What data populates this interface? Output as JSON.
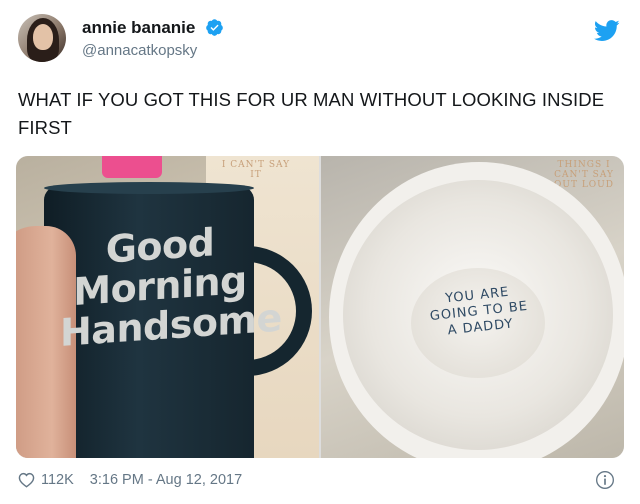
{
  "user": {
    "display_name": "annie bananie",
    "handle": "@annacatkopsky",
    "avatar_icon": "profile-photo"
  },
  "tweet": {
    "text": "WHAT IF YOU GOT THIS FOR UR MAN WITHOUT LOOKING INSIDE FIRST"
  },
  "media": {
    "left_photo": {
      "mug_text_lines": [
        "Good",
        "Morning",
        "Handsome"
      ],
      "card_text": "I CAN'T SAY IT"
    },
    "right_photo": {
      "cup_text_lines": [
        "YOU ARE",
        "GOING TO BE",
        "A DADDY"
      ],
      "card_text": "THINGS I CAN'T SAY OUT LOUD"
    }
  },
  "footer": {
    "likes": "112K",
    "timestamp": "3:16 PM - Aug 12, 2017"
  },
  "colors": {
    "twitter_blue": "#1da1f2",
    "text": "#14171a",
    "secondary": "#657786"
  },
  "icons": {
    "verified": "verified-badge-icon",
    "bird": "twitter-bird-icon",
    "like": "heart-icon",
    "info": "info-icon"
  }
}
